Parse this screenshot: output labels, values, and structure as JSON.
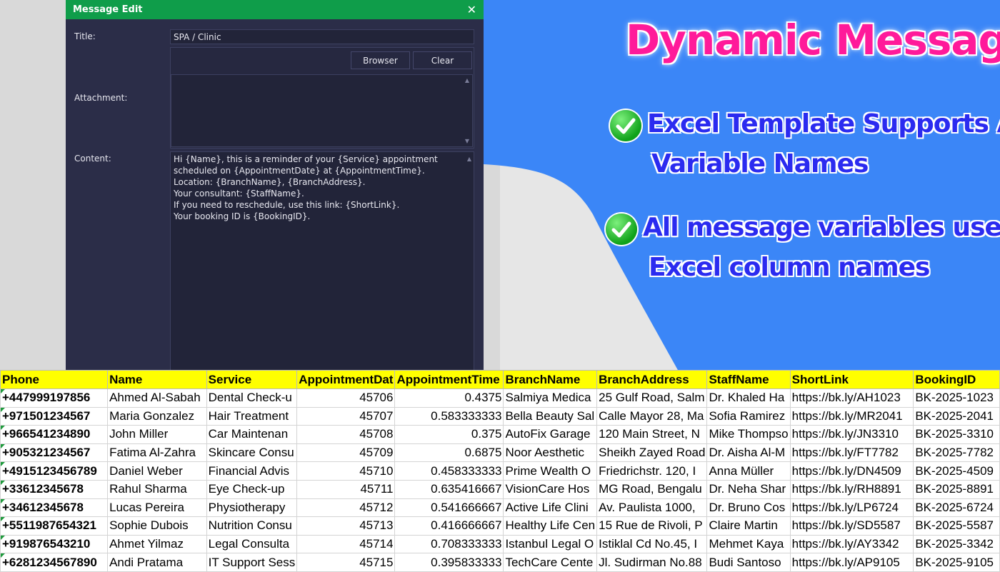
{
  "dialog": {
    "title": "Message Edit",
    "close_glyph": "✕",
    "title_label": "Title:",
    "title_value": "SPA / Clinic",
    "attachment_label": "Attachment:",
    "browser_label": "Browser",
    "clear_label": "Clear",
    "content_label": "Content:",
    "content_value": "Hi {Name}, this is a reminder of your {Service} appointment\nscheduled on {AppointmentDate} at {AppointmentTime}.\nLocation: {BranchName}, {BranchAddress}.\nYour consultant: {StaffName}.\nIf you need to reschedule, use this link: {ShortLink}.\nYour booking ID is {BookingID}."
  },
  "promo": {
    "headline": "Dynamic Message",
    "feature1_line1": "Excel Template Supports Any",
    "feature1_line2": "Variable Names",
    "feature2_line1": "All message variables use",
    "feature2_line2": "Excel column names",
    "headline_color": "#ff1a9a",
    "feature_color": "#2b2bf0",
    "background_color": "#3b86f7"
  },
  "sheet": {
    "headers": [
      "Phone",
      "Name",
      "Service",
      "AppointmentDat",
      "AppointmentTime",
      "BranchName",
      "BranchAddress",
      "StaffName",
      "ShortLink",
      "BookingID"
    ],
    "rows": [
      [
        "+447999197856",
        "Ahmed Al-Sabah",
        "Dental Check-u",
        "45706",
        "0.4375",
        "Salmiya Medica",
        "25 Gulf Road, Salm",
        "Dr. Khaled Ha",
        "https://bk.ly/AH1023",
        "BK-2025-1023"
      ],
      [
        "+971501234567",
        "Maria Gonzalez",
        "Hair Treatment",
        "45707",
        "0.583333333",
        "Bella Beauty Sal",
        "Calle Mayor 28, Ma",
        "Sofia Ramirez",
        "https://bk.ly/MR2041",
        "BK-2025-2041"
      ],
      [
        "+966541234890",
        "John Miller",
        "Car Maintenan",
        "45708",
        "0.375",
        "AutoFix Garage",
        "120 Main Street, N",
        "Mike Thompso",
        "https://bk.ly/JN3310",
        "BK-2025-3310"
      ],
      [
        "+905321234567",
        "Fatima Al-Zahra",
        "Skincare Consu",
        "45709",
        "0.6875",
        "Noor Aesthetic",
        "Sheikh Zayed Road",
        "Dr. Aisha Al-M",
        "https://bk.ly/FT7782",
        "BK-2025-7782"
      ],
      [
        "+4915123456789",
        "Daniel Weber",
        "Financial Advis",
        "45710",
        "0.458333333",
        "Prime Wealth O",
        "Friedrichstr. 120, I",
        "Anna Müller",
        "https://bk.ly/DN4509",
        "BK-2025-4509"
      ],
      [
        "+33612345678",
        "Rahul Sharma",
        "Eye Check-up",
        "45711",
        "0.635416667",
        "VisionCare Hos",
        "MG Road, Bengalu",
        "Dr. Neha Shar",
        "https://bk.ly/RH8891",
        "BK-2025-8891"
      ],
      [
        "+34612345678",
        "Lucas Pereira",
        "Physiotherapy",
        "45712",
        "0.541666667",
        "Active Life Clini",
        "Av. Paulista 1000,",
        "Dr. Bruno Cos",
        "https://bk.ly/LP6724",
        "BK-2025-6724"
      ],
      [
        "+5511987654321",
        "Sophie Dubois",
        "Nutrition Consu",
        "45713",
        "0.416666667",
        "Healthy Life Cen",
        "15 Rue de Rivoli, P",
        "Claire Martin",
        "https://bk.ly/SD5587",
        "BK-2025-5587"
      ],
      [
        "+919876543210",
        "Ahmet Yilmaz",
        "Legal Consulta",
        "45714",
        "0.708333333",
        "Istanbul Legal O",
        "Istiklal Cd No.45, I",
        "Mehmet Kaya",
        "https://bk.ly/AY3342",
        "BK-2025-3342"
      ],
      [
        "+6281234567890",
        "Andi Pratama",
        "IT Support Sess",
        "45715",
        "0.395833333",
        "TechCare Cente",
        "Jl. Sudirman No.88",
        "Budi Santoso",
        "https://bk.ly/AP9105",
        "BK-2025-9105"
      ]
    ]
  }
}
